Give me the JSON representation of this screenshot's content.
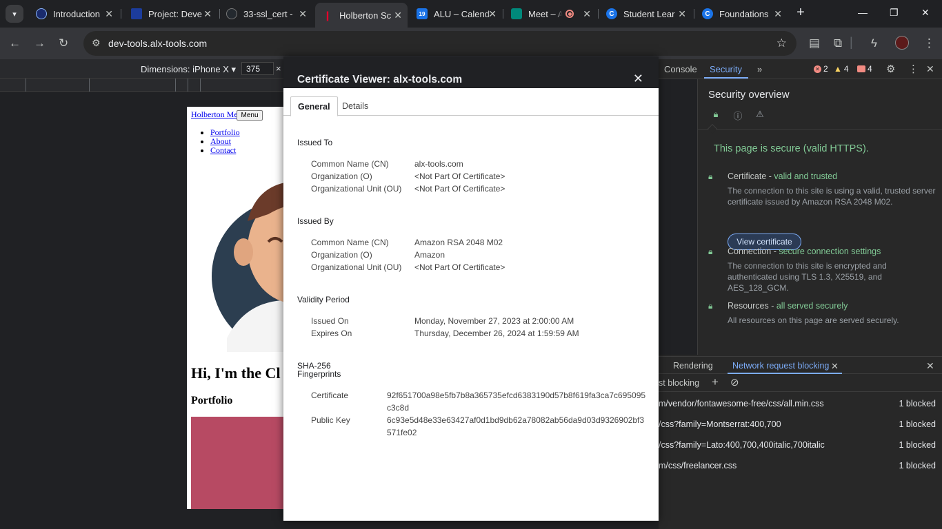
{
  "browser": {
    "tabs": [
      {
        "title": "Introduction",
        "favicon_color": "#1a2b6d"
      },
      {
        "title": "Project: Deve",
        "favicon_color": "#1c3c9c"
      },
      {
        "title": "33-ssl_cert -",
        "favicon_color": "#24292f"
      },
      {
        "title": "Holberton Sc",
        "favicon_color": "#e4002b"
      },
      {
        "title": "ALU – Calend",
        "favicon_color": "#1a73e8"
      },
      {
        "title": "Meet – A",
        "favicon_color": "#00897b"
      },
      {
        "title": "Student Lear",
        "favicon_color": "#1a73e8"
      },
      {
        "title": "Foundations",
        "favicon_color": "#1a73e8"
      }
    ],
    "url": "dev-tools.alx-tools.com"
  },
  "device_toolbar": {
    "dimensions_label": "Dimensions: iPhone X",
    "width_value": "375",
    "times": "×"
  },
  "page": {
    "brand": "Holberton Me",
    "menu_button": "Menu",
    "nav": [
      "Portfolio",
      "About",
      "Contact"
    ],
    "heading": "Hi, I'm the Cl",
    "portfolio_heading": "Portfolio",
    "accent": "#b74a63"
  },
  "cert_viewer": {
    "title": "Certificate Viewer: alx-tools.com",
    "tabs": [
      "General",
      "Details"
    ],
    "issued_to": {
      "heading": "Issued To",
      "rows": [
        {
          "k": "Common Name (CN)",
          "v": "alx-tools.com"
        },
        {
          "k": "Organization (O)",
          "v": "<Not Part Of Certificate>"
        },
        {
          "k": "Organizational Unit (OU)",
          "v": "<Not Part Of Certificate>"
        }
      ]
    },
    "issued_by": {
      "heading": "Issued By",
      "rows": [
        {
          "k": "Common Name (CN)",
          "v": "Amazon RSA 2048 M02"
        },
        {
          "k": "Organization (O)",
          "v": "Amazon"
        },
        {
          "k": "Organizational Unit (OU)",
          "v": "<Not Part Of Certificate>"
        }
      ]
    },
    "validity": {
      "heading": "Validity Period",
      "rows": [
        {
          "k": "Issued On",
          "v": "Monday, November 27, 2023 at 2:00:00 AM"
        },
        {
          "k": "Expires On",
          "v": "Thursday, December 26, 2024 at 1:59:59 AM"
        }
      ]
    },
    "fingerprints": {
      "heading_line1": "SHA-256",
      "heading_line2": "Fingerprints",
      "rows": [
        {
          "k": "Certificate",
          "v": "92f651700a98e5fb7b8a365735efcd6383190d57b8f619fa3ca7c695095c3c8d"
        },
        {
          "k": "Public Key",
          "v": "6c93e5d48e33e63427af0d1bd9db62a78082ab56da9d03d9326902bf3571fe02"
        }
      ]
    }
  },
  "devtools": {
    "tabs": [
      "Console",
      "Security"
    ],
    "more": "»",
    "errors": "2",
    "warnings": "4",
    "issues": "4",
    "security": {
      "title": "Security overview",
      "secure_text": "This page is secure (valid HTTPS).",
      "certificate": {
        "label": "Certificate - ",
        "status": "valid and trusted",
        "desc": "The connection to this site is using a valid, trusted server certificate issued by Amazon RSA 2048 M02."
      },
      "view_certificate_button": "View certificate",
      "connection": {
        "label": "Connection - ",
        "status": "secure connection settings",
        "desc": "The connection to this site is encrypted and authenticated using TLS 1.3, X25519, and AES_128_GCM."
      },
      "resources": {
        "label": "Resources - ",
        "status": "all served securely",
        "desc": "All resources on this page are served securely."
      }
    },
    "drawer": {
      "tabs": [
        "Rendering",
        "Network request blocking"
      ],
      "toolbar_label": "st blocking",
      "rows": [
        {
          "pattern": "m/vendor/fontawesome-free/css/all.min.css",
          "count": "1 blocked"
        },
        {
          "pattern": "/css?family=Montserrat:400,700",
          "count": "1 blocked"
        },
        {
          "pattern": "/css?family=Lato:400,700,400italic,700italic",
          "count": "1 blocked"
        },
        {
          "pattern": "m/css/freelancer.css",
          "count": "1 blocked"
        }
      ]
    },
    "colors": {
      "accent": "#7cacf8",
      "secure_green": "#81c995"
    }
  }
}
